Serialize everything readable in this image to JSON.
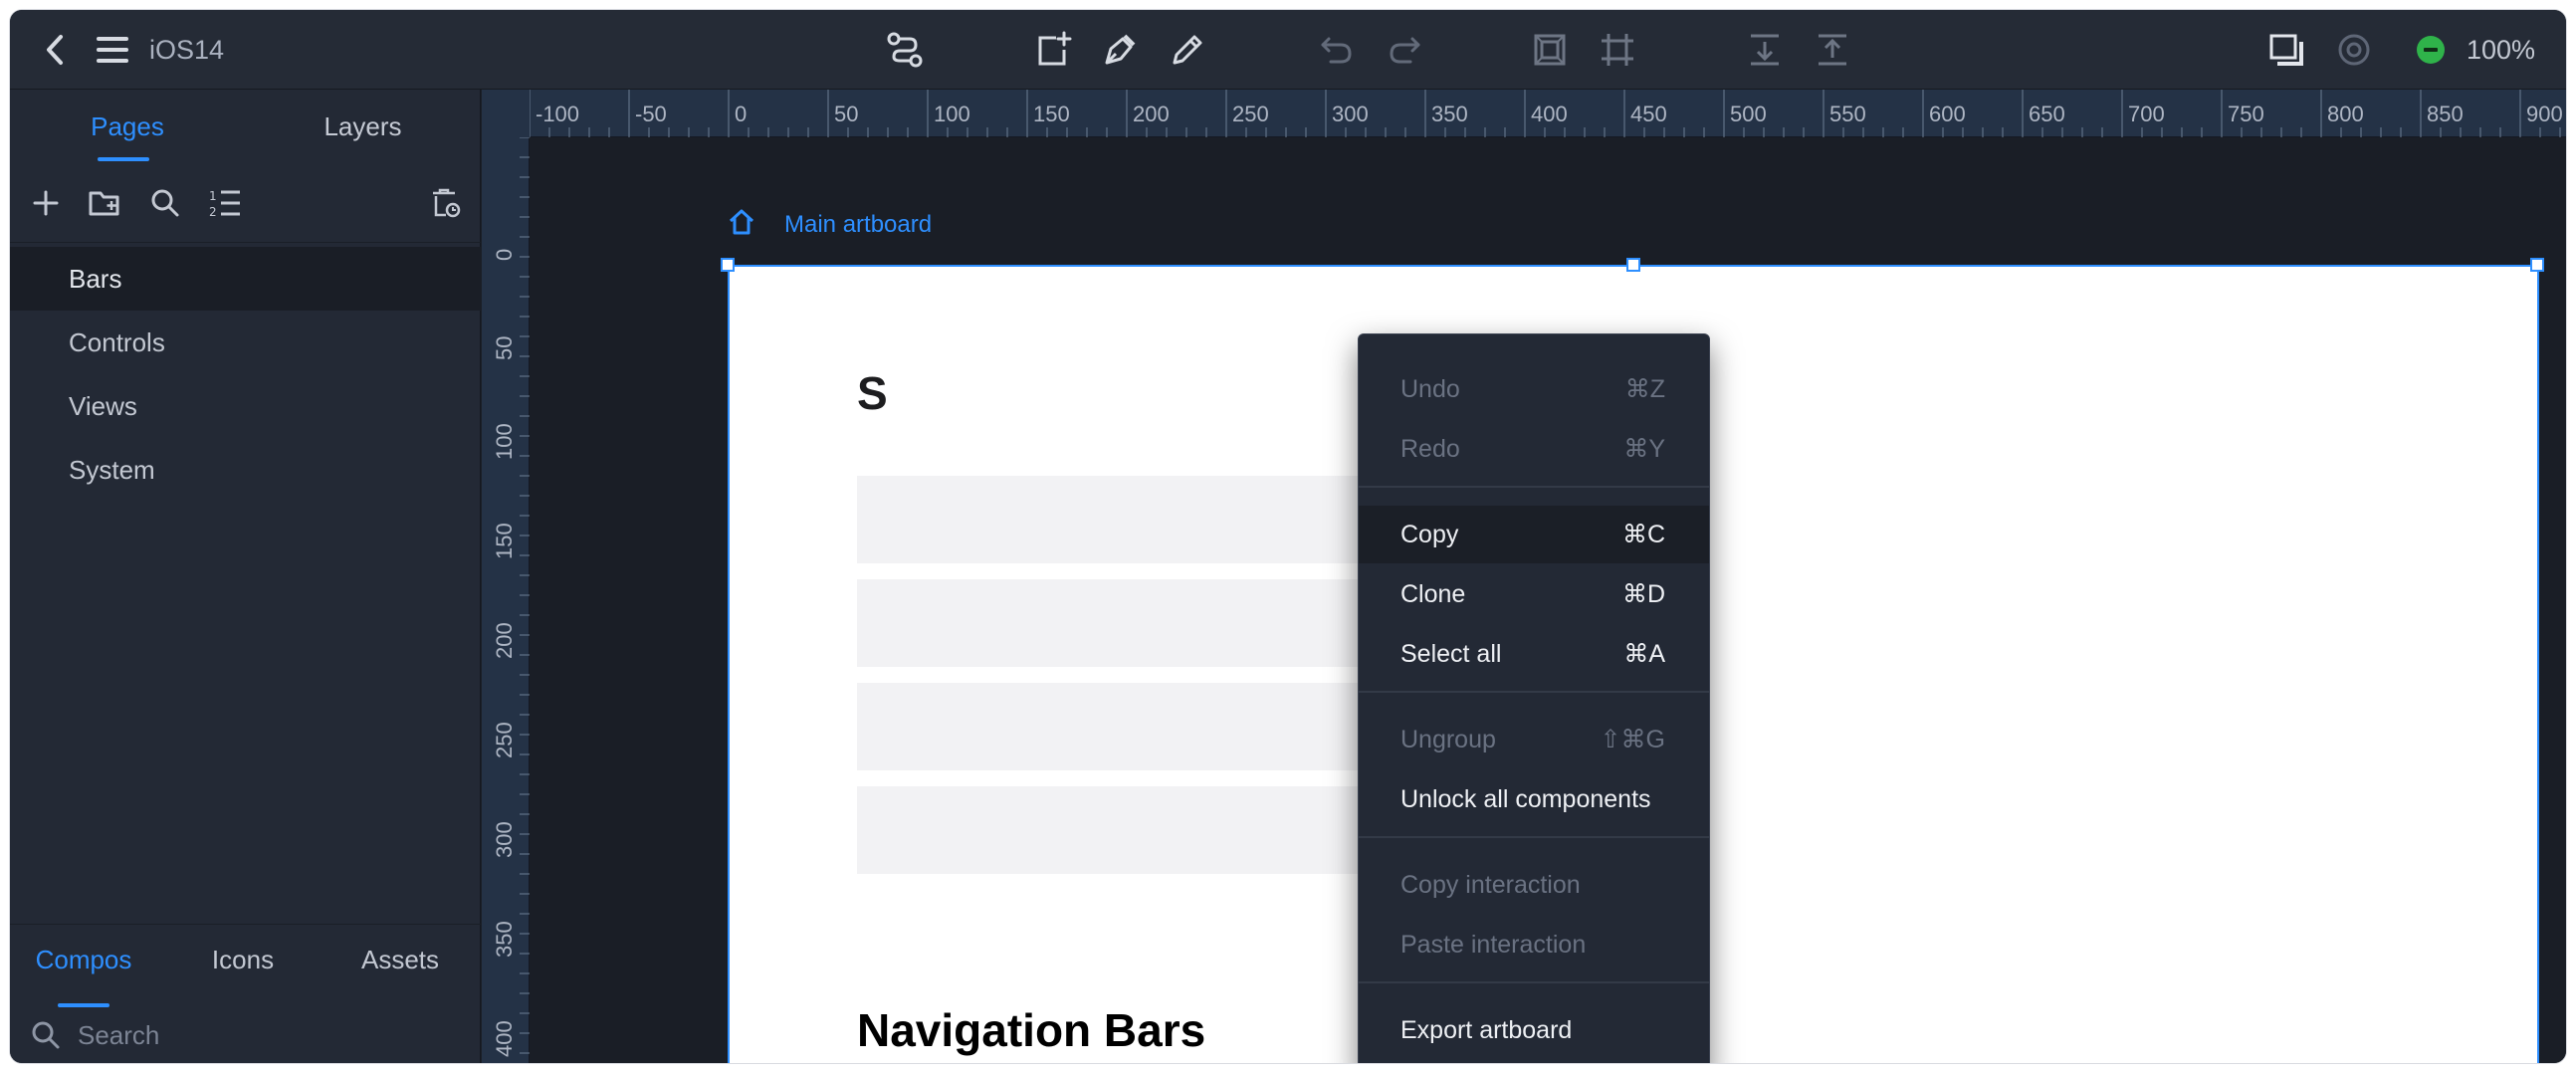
{
  "app": {
    "title": "iOS14",
    "zoom": "100%",
    "colors": {
      "accent": "#2e8fff",
      "status": "#2fb34a",
      "panel": "#232935",
      "canvas": "#1a1e26"
    }
  },
  "toolbar": {
    "icons": [
      "back-icon",
      "menu-icon",
      "link-path-icon",
      "add-artboard-icon",
      "pen-icon",
      "pencil-icon",
      "undo-icon",
      "redo-icon",
      "frame-icon",
      "frame-tool-icon",
      "align-bottom-icon",
      "align-top-icon",
      "preview-icon",
      "settings-icon"
    ]
  },
  "left_panel": {
    "tabs": [
      "Pages",
      "Layers"
    ],
    "pages": [
      "Bars",
      "Controls",
      "Views",
      "System"
    ],
    "bottom_tabs": [
      "Compos",
      "Icons",
      "Assets"
    ],
    "search_placeholder": "Search"
  },
  "rulers": {
    "horizontal": [
      "-100",
      "-50",
      "0",
      "50",
      "100",
      "150",
      "200",
      "250",
      "300",
      "350",
      "400",
      "450",
      "500",
      "550",
      "600",
      "650",
      "700",
      "750",
      "800",
      "850",
      "900"
    ],
    "vertical": [
      "0",
      "50",
      "100",
      "150",
      "200",
      "250",
      "300",
      "350",
      "400"
    ]
  },
  "artboard": {
    "label": "Main artboard",
    "heading_partial": "S",
    "heading_nav": "Navigation Bars"
  },
  "context_menu": {
    "groups": [
      [
        {
          "label": "Undo",
          "shortcut": "⌘Z",
          "enabled": false
        },
        {
          "label": "Redo",
          "shortcut": "⌘Y",
          "enabled": false
        }
      ],
      [
        {
          "label": "Copy",
          "shortcut": "⌘C",
          "enabled": true,
          "highlighted": true
        },
        {
          "label": "Clone",
          "shortcut": "⌘D",
          "enabled": true
        },
        {
          "label": "Select all",
          "shortcut": "⌘A",
          "enabled": true
        }
      ],
      [
        {
          "label": "Ungroup",
          "shortcut": "⇧⌘G",
          "enabled": false
        },
        {
          "label": "Unlock all components",
          "shortcut": "",
          "enabled": true
        }
      ],
      [
        {
          "label": "Copy interaction",
          "shortcut": "",
          "enabled": false
        },
        {
          "label": "Paste interaction",
          "shortcut": "",
          "enabled": false
        }
      ],
      [
        {
          "label": "Export artboard",
          "shortcut": "",
          "enabled": true
        }
      ]
    ]
  }
}
